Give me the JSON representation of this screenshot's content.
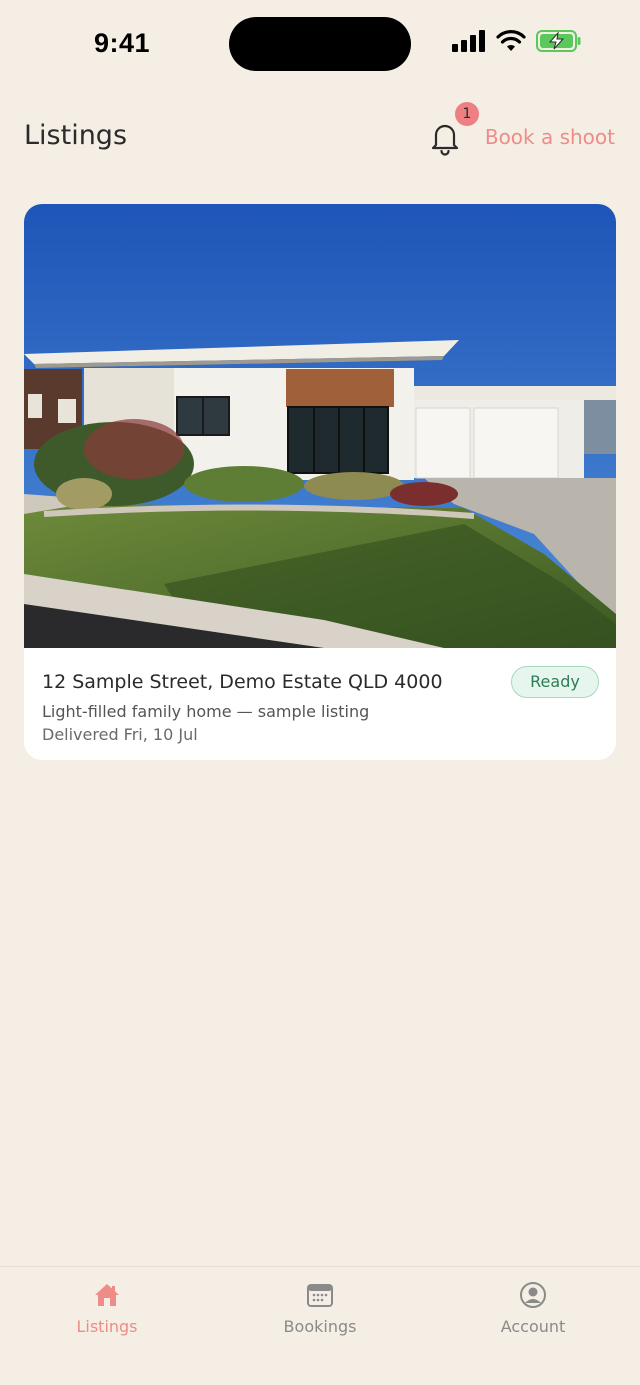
{
  "status_bar": {
    "time": "9:41"
  },
  "header": {
    "title": "Listings",
    "notification_count": "1",
    "book_shoot_label": "Book a shoot"
  },
  "listing": {
    "address": "12 Sample Street, Demo Estate QLD 4000",
    "description": "Light-filled family home — sample listing",
    "delivered": "Delivered Fri, 10 Jul",
    "status": "Ready"
  },
  "tabs": [
    {
      "label": "Listings",
      "icon": "home-icon",
      "active": true
    },
    {
      "label": "Bookings",
      "icon": "calendar-icon",
      "active": false
    },
    {
      "label": "Account",
      "icon": "account-icon",
      "active": false
    }
  ],
  "colors": {
    "background": "#F5EEE5",
    "accent": "#EE8C88",
    "badge_green_bg": "#E6F5EE",
    "badge_green_text": "#2E7D52"
  }
}
